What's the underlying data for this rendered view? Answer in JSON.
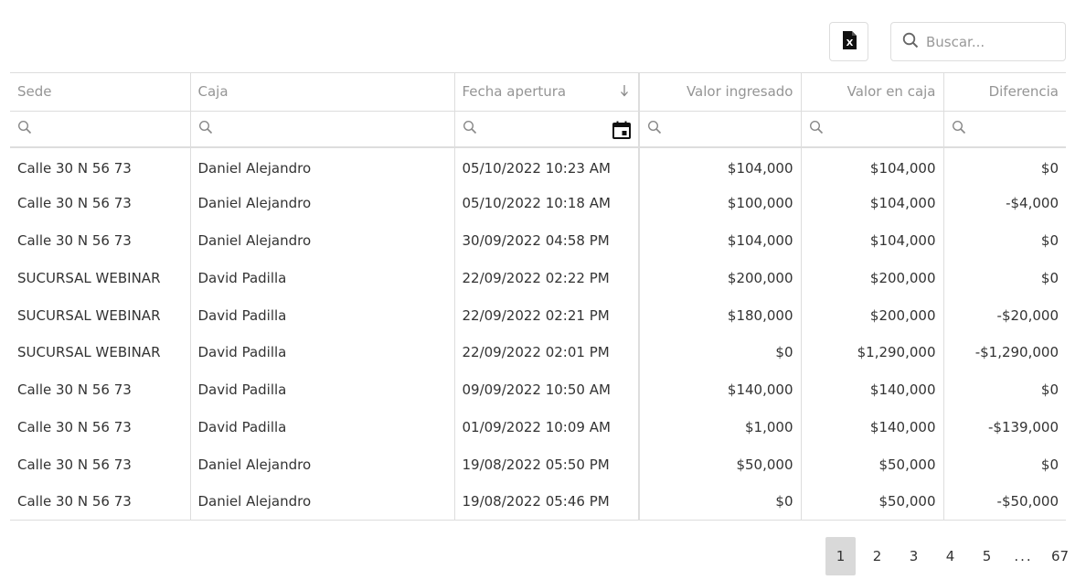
{
  "toolbar": {
    "export_icon": "excel-file-icon",
    "search_placeholder": "Buscar..."
  },
  "columns": [
    "Sede",
    "Caja",
    "Fecha apertura",
    "Valor ingresado",
    "Valor en caja",
    "Diferencia"
  ],
  "rows": [
    [
      "Calle 30 N 56 73",
      "Daniel Alejandro",
      "05/10/2022 10:23 AM",
      "$104,000",
      "$104,000",
      "$0"
    ],
    [
      "Calle 30 N 56 73",
      "Daniel Alejandro",
      "05/10/2022 10:18 AM",
      "$100,000",
      "$104,000",
      "-$4,000"
    ],
    [
      "Calle 30 N 56 73",
      "Daniel Alejandro",
      "30/09/2022 04:58 PM",
      "$104,000",
      "$104,000",
      "$0"
    ],
    [
      "SUCURSAL WEBINAR",
      "David Padilla",
      "22/09/2022 02:22 PM",
      "$200,000",
      "$200,000",
      "$0"
    ],
    [
      "SUCURSAL WEBINAR",
      "David Padilla",
      "22/09/2022 02:21 PM",
      "$180,000",
      "$200,000",
      "-$20,000"
    ],
    [
      "SUCURSAL WEBINAR",
      "David Padilla",
      "22/09/2022 02:01 PM",
      "$0",
      "$1,290,000",
      "-$1,290,000"
    ],
    [
      "Calle 30 N 56 73",
      "David Padilla",
      "09/09/2022 10:50 AM",
      "$140,000",
      "$140,000",
      "$0"
    ],
    [
      "Calle 30 N 56 73",
      "David Padilla",
      "01/09/2022 10:09 AM",
      "$1,000",
      "$140,000",
      "-$139,000"
    ],
    [
      "Calle 30 N 56 73",
      "Daniel Alejandro",
      "19/08/2022 05:50 PM",
      "$50,000",
      "$50,000",
      "$0"
    ],
    [
      "Calle 30 N 56 73",
      "Daniel Alejandro",
      "19/08/2022 05:46 PM",
      "$0",
      "$50,000",
      "-$50,000"
    ]
  ],
  "pagination": {
    "pages": [
      "1",
      "2",
      "3",
      "4",
      "5"
    ],
    "ellipsis": "...",
    "last": "67",
    "current": "1"
  },
  "colors": {
    "border": "#dddddd",
    "header_text": "#959595",
    "active_page": "#d9d9d9"
  }
}
